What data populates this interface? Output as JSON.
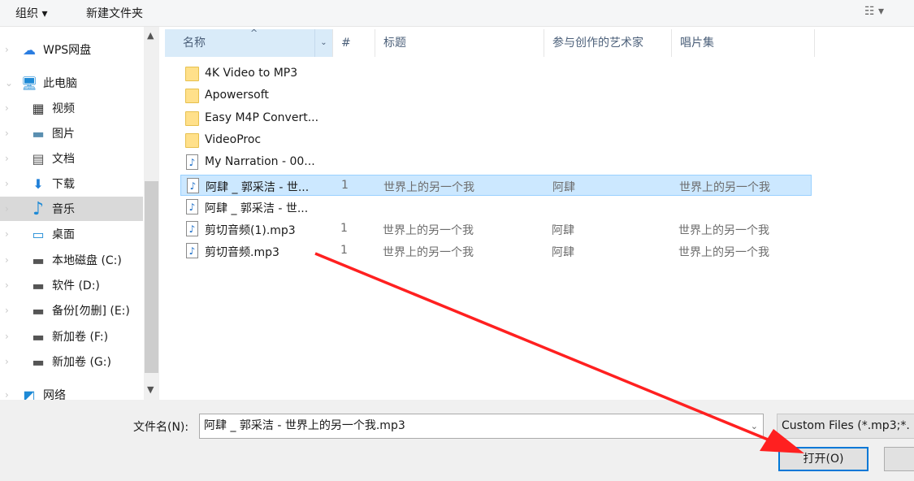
{
  "toolbar": {
    "organize": "组织 ▾",
    "new_folder": "新建文件夹",
    "view_icon": "view-options-icon"
  },
  "nav": [
    {
      "label": "WPS网盘",
      "icon": "cloud-icon"
    },
    {
      "label": "此电脑",
      "icon": "computer-icon"
    },
    {
      "label": "视频",
      "icon": "video-icon"
    },
    {
      "label": "图片",
      "icon": "pictures-icon"
    },
    {
      "label": "文档",
      "icon": "documents-icon"
    },
    {
      "label": "下载",
      "icon": "download-icon"
    },
    {
      "label": "音乐",
      "icon": "music-icon"
    },
    {
      "label": "桌面",
      "icon": "desktop-icon"
    },
    {
      "label": "本地磁盘 (C:)",
      "icon": "drive-icon"
    },
    {
      "label": "软件 (D:)",
      "icon": "drive-icon"
    },
    {
      "label": "备份[勿删] (E:)",
      "icon": "drive-icon"
    },
    {
      "label": "新加卷 (F:)",
      "icon": "drive-icon"
    },
    {
      "label": "新加卷 (G:)",
      "icon": "drive-icon"
    },
    {
      "label": "网络",
      "icon": "network-icon"
    }
  ],
  "columns": {
    "name": "名称",
    "num": "#",
    "title": "标题",
    "artist": "参与创作的艺术家",
    "album": "唱片集"
  },
  "files": [
    {
      "name": "4K Video to MP3",
      "type": "folder",
      "num": "",
      "title": "",
      "artist": "",
      "album": ""
    },
    {
      "name": "Apowersoft",
      "type": "folder",
      "num": "",
      "title": "",
      "artist": "",
      "album": ""
    },
    {
      "name": "Easy M4P Convert...",
      "type": "folder",
      "num": "",
      "title": "",
      "artist": "",
      "album": ""
    },
    {
      "name": "VideoProc",
      "type": "folder",
      "num": "",
      "title": "",
      "artist": "",
      "album": ""
    },
    {
      "name": "My Narration - 00...",
      "type": "audio",
      "num": "",
      "title": "",
      "artist": "",
      "album": ""
    },
    {
      "name": "阿肆 _ 郭采洁 - 世...",
      "type": "audio",
      "num": "1",
      "title": "世界上的另一个我",
      "artist": "阿肆",
      "album": "世界上的另一个我"
    },
    {
      "name": "阿肆 _ 郭采洁 - 世...",
      "type": "audio",
      "num": "",
      "title": "",
      "artist": "",
      "album": ""
    },
    {
      "name": "剪切音频(1).mp3",
      "type": "audio",
      "num": "1",
      "title": "世界上的另一个我",
      "artist": "阿肆",
      "album": "世界上的另一个我"
    },
    {
      "name": "剪切音频.mp3",
      "type": "audio",
      "num": "1",
      "title": "世界上的另一个我",
      "artist": "阿肆",
      "album": "世界上的另一个我"
    }
  ],
  "bottom": {
    "filename_label": "文件名(N):",
    "filename_value": "阿肆 _ 郭采洁 - 世界上的另一个我.mp3",
    "filetype": "Custom Files (*.mp3;*.",
    "open": "打开(O)"
  },
  "colors": {
    "selection": "#cce8ff",
    "accent": "#0078d7",
    "arrow": "#ff2020"
  }
}
